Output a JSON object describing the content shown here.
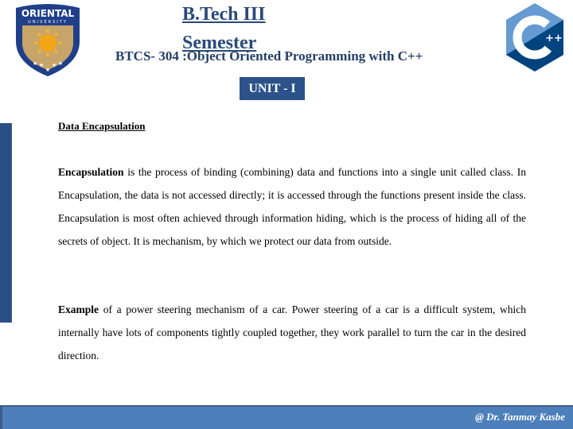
{
  "header": {
    "title_line1": "B.Tech III",
    "title_line2": "Semester",
    "subtitle": "BTCS- 304 :Object Oriented Programming with C++",
    "unit_badge": "UNIT - I"
  },
  "logos": {
    "left": {
      "name": "oriental-university-logo",
      "text_top": "ORIENTAL",
      "text_bottom": "UNIVERSITY"
    },
    "right": {
      "name": "cpp-logo",
      "text": "C",
      "plus": "++"
    }
  },
  "content": {
    "section_heading": "Data Encapsulation",
    "paragraph1": {
      "bold_lead": "Encapsulation",
      "text": " is the process of binding (combining) data and functions into a single unit called class. In Encapsulation, the data is not accessed directly; it is accessed through the functions present inside the class. Encapsulation is most often achieved through information hiding, which is the process of hiding all of the secrets of object. It is mechanism, by which we protect our data from outside."
    },
    "paragraph2": {
      "bold_lead": "Example",
      "text": " of a power steering mechanism of a car. Power steering of a car is a difficult system, which internally have lots of components tightly coupled together, they work parallel to turn the car in the desired direction."
    }
  },
  "footer": {
    "credit": "@ Dr. Tanmay Kasbe"
  },
  "colors": {
    "title": "#284a7a",
    "badge_bg": "#2b5289",
    "footer_bg": "#4d7fbb",
    "left_bar": "#2a4e86"
  }
}
